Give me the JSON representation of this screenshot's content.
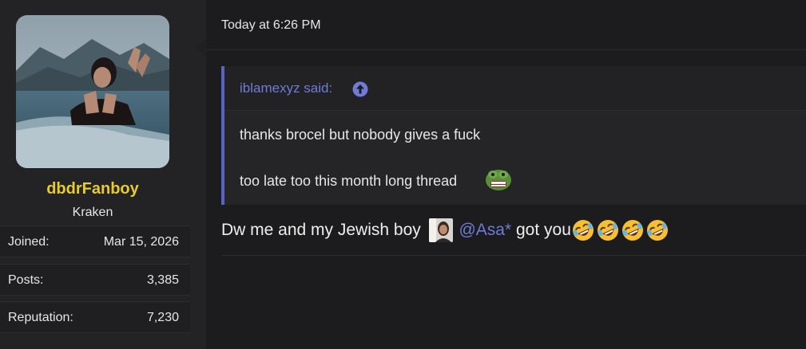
{
  "user": {
    "username": "dbdrFanboy",
    "title": "Kraken",
    "stats": [
      {
        "label": "Joined:",
        "value": "Mar 15, 2026"
      },
      {
        "label": "Posts:",
        "value": "3,385"
      },
      {
        "label": "Reputation:",
        "value": "7,230"
      }
    ]
  },
  "post": {
    "timestamp": "Today at 6:26 PM",
    "quote": {
      "author": "iblamexyz said:",
      "line1": "thanks brocel but nobody gives a fuck",
      "line2": "too late too this month long thread"
    },
    "body": {
      "text_before": "Dw me and my Jewish boy",
      "mention": "@Asa*",
      "text_after": "got you"
    }
  },
  "colors": {
    "username": "#e6cc2c",
    "accent": "#6f7bd6",
    "quote_border": "#5a62c2"
  },
  "icons": {
    "quote_link": "arrow-up-circle-icon",
    "quote_emoji": "pepe-icon",
    "body_emoji": "rofl-icon"
  }
}
